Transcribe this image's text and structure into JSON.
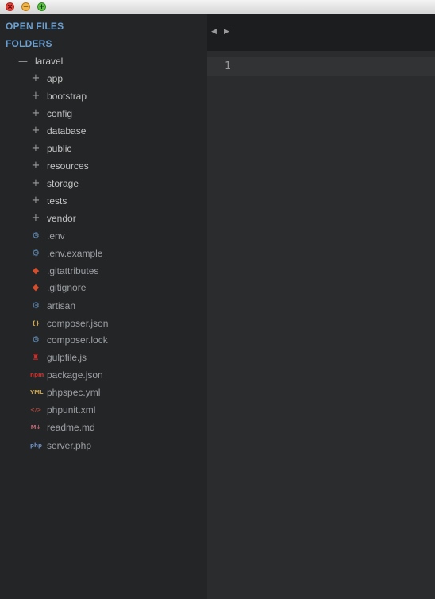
{
  "window": {
    "controls": {
      "close_glyph": "×",
      "minimize_glyph": "−",
      "maximize_glyph": "+"
    }
  },
  "sidebar": {
    "open_files_label": "OPEN FILES",
    "folders_label": "FOLDERS",
    "root": {
      "name": "laravel",
      "toggle_glyph": "—"
    },
    "folders": [
      {
        "name": "app",
        "glyph": "+"
      },
      {
        "name": "bootstrap",
        "glyph": "+"
      },
      {
        "name": "config",
        "glyph": "+"
      },
      {
        "name": "database",
        "glyph": "+"
      },
      {
        "name": "public",
        "glyph": "+"
      },
      {
        "name": "resources",
        "glyph": "+"
      },
      {
        "name": "storage",
        "glyph": "+"
      },
      {
        "name": "tests",
        "glyph": "+"
      },
      {
        "name": "vendor",
        "glyph": "+"
      }
    ],
    "files": [
      {
        "name": ".env",
        "icon": "gear-icon",
        "glyph": "⚙",
        "color": "#5b86b0"
      },
      {
        "name": ".env.example",
        "icon": "gear-icon",
        "glyph": "⚙",
        "color": "#5b86b0"
      },
      {
        "name": ".gitattributes",
        "icon": "git-icon",
        "glyph": "◆",
        "color": "#d24e2c"
      },
      {
        "name": ".gitignore",
        "icon": "git-icon",
        "glyph": "◆",
        "color": "#d24e2c"
      },
      {
        "name": "artisan",
        "icon": "gear-icon",
        "glyph": "⚙",
        "color": "#5b86b0"
      },
      {
        "name": "composer.json",
        "icon": "braces-icon",
        "glyph": "{}",
        "color": "#d4a94e"
      },
      {
        "name": "composer.lock",
        "icon": "gear-icon",
        "glyph": "⚙",
        "color": "#5b86b0"
      },
      {
        "name": "gulpfile.js",
        "icon": "gulp-icon",
        "glyph": "♜",
        "color": "#c9302c"
      },
      {
        "name": "package.json",
        "icon": "npm-icon",
        "glyph": "npm",
        "color": "#c9302c"
      },
      {
        "name": "phpspec.yml",
        "icon": "yml-icon",
        "glyph": "YML",
        "color": "#c8a04a"
      },
      {
        "name": "phpunit.xml",
        "icon": "code-icon",
        "glyph": "</>",
        "color": "#b0473a"
      },
      {
        "name": "readme.md",
        "icon": "markdown-icon",
        "glyph": "M↓",
        "color": "#c0616d"
      },
      {
        "name": "server.php",
        "icon": "php-icon",
        "glyph": "php",
        "color": "#6c8fc0"
      }
    ]
  },
  "editor": {
    "nav_back_glyph": "◀",
    "nav_forward_glyph": "▶",
    "line_numbers": [
      "1"
    ]
  }
}
